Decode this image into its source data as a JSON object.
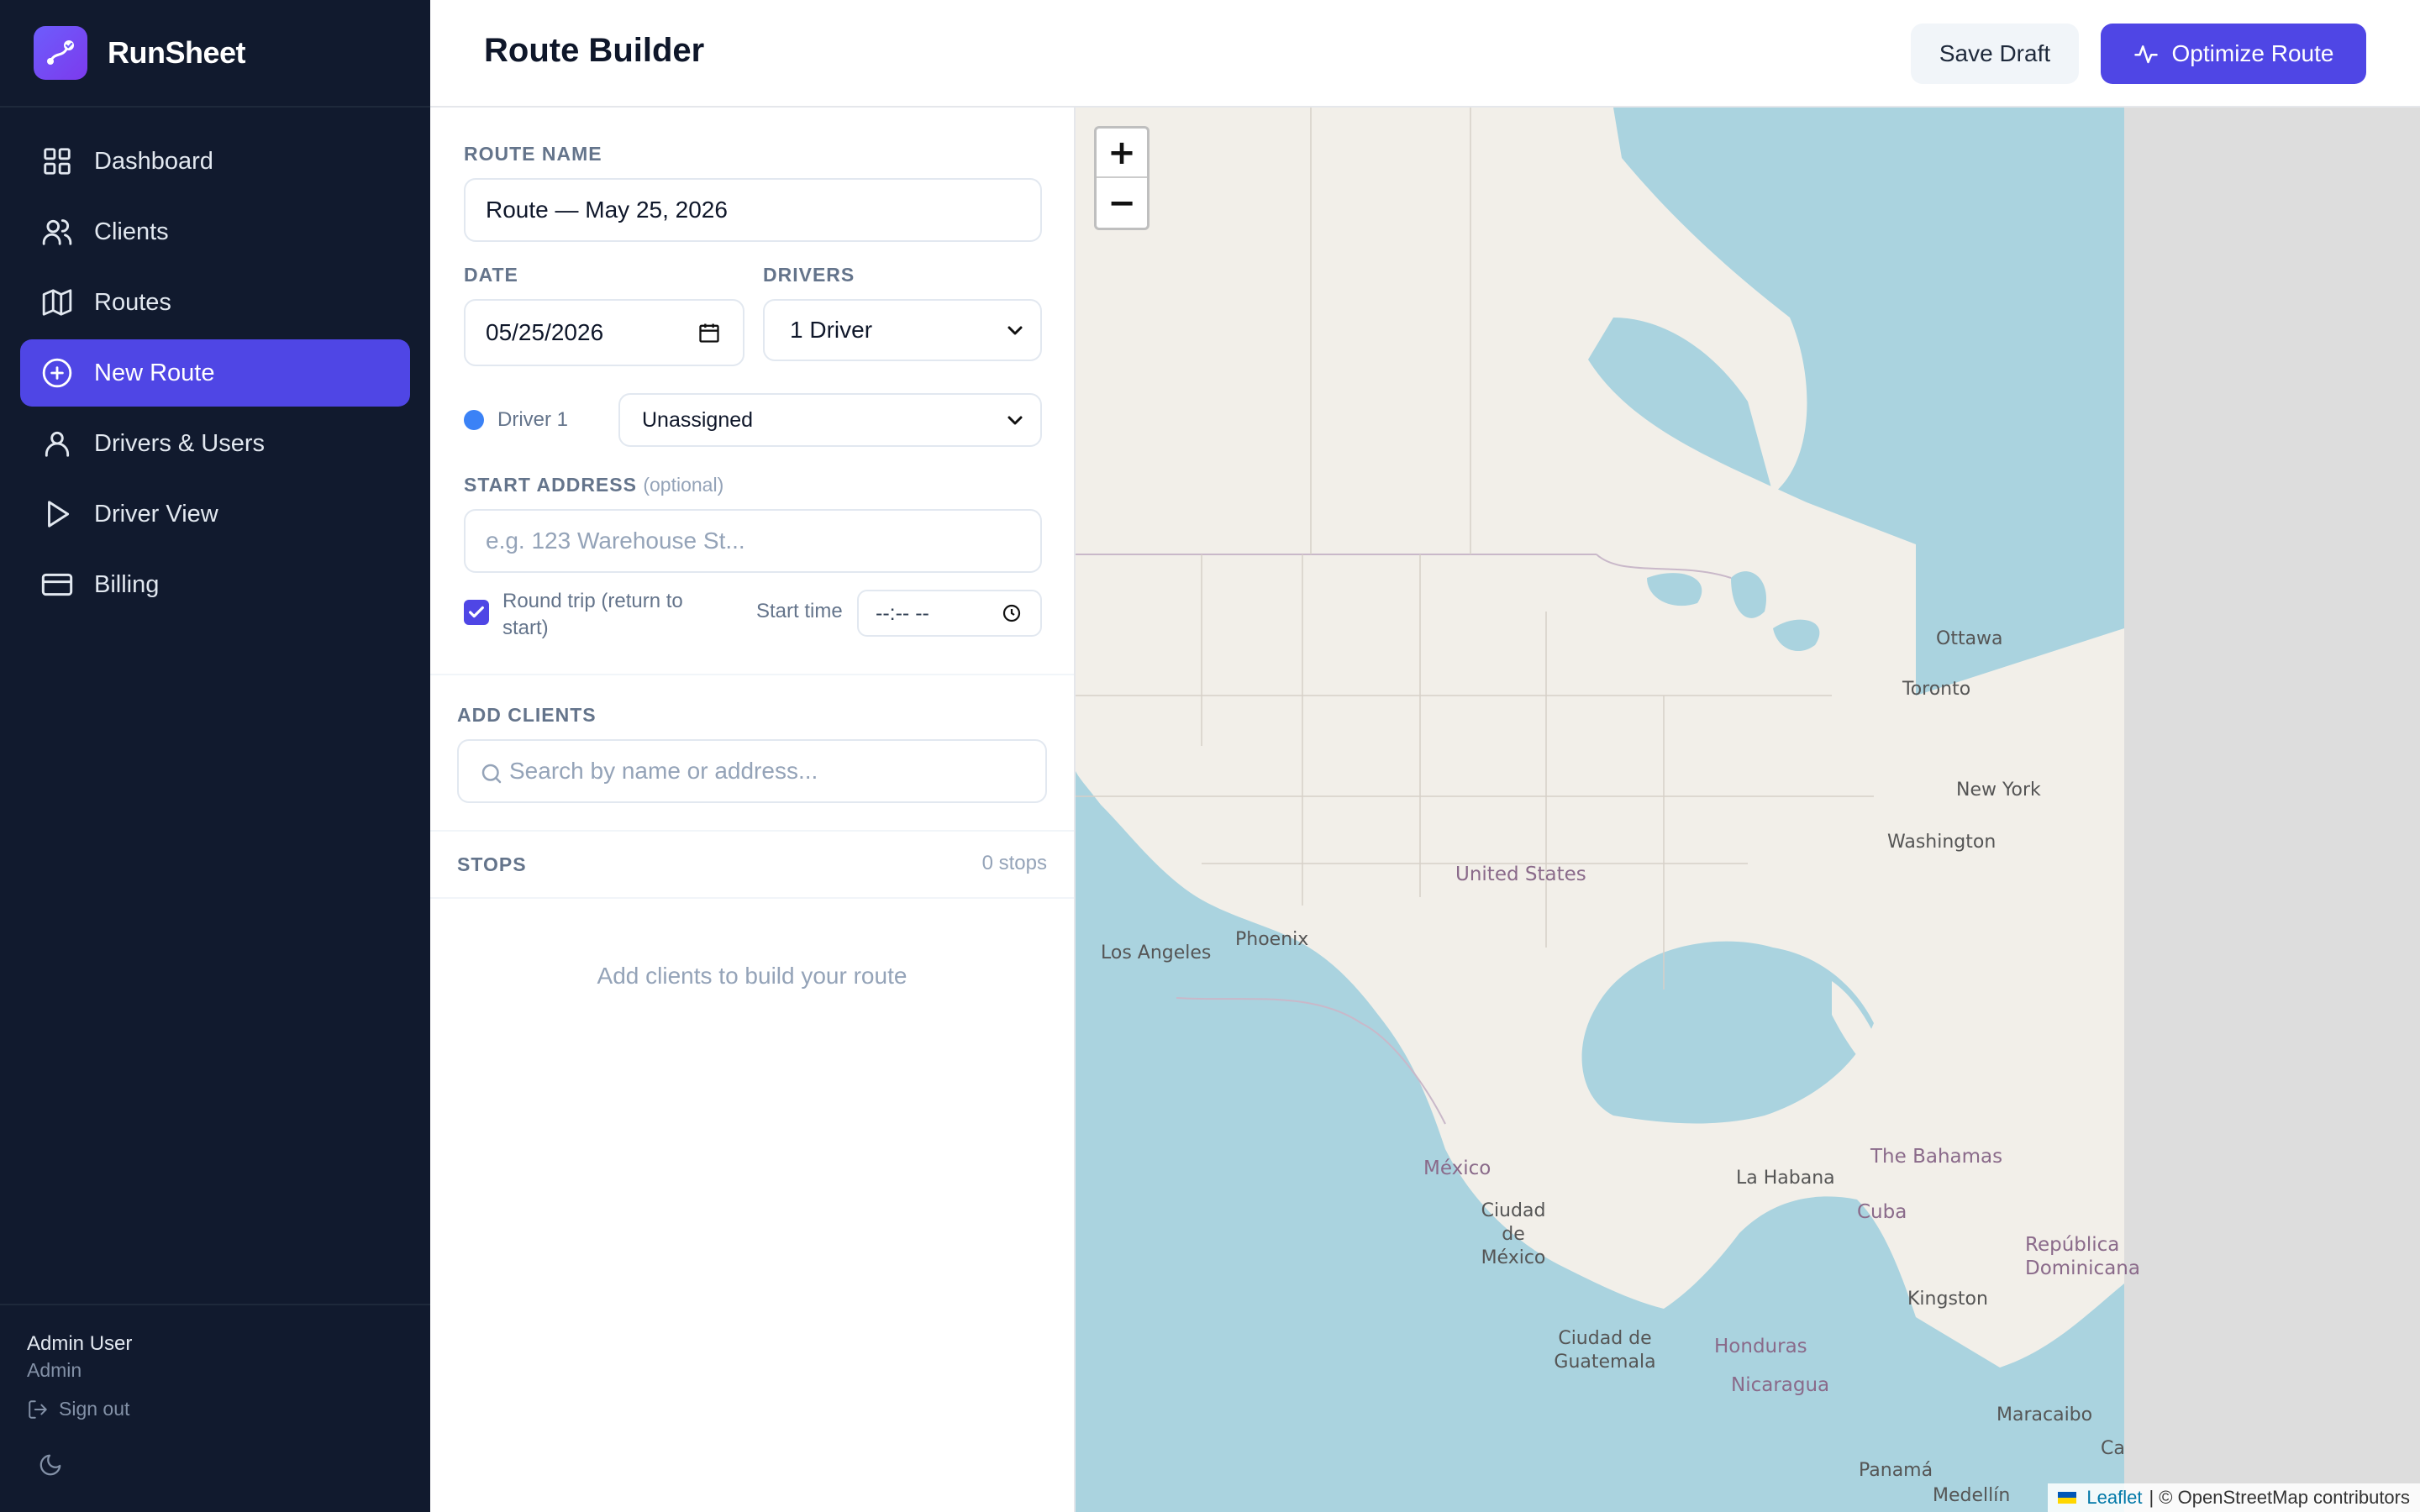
{
  "app": {
    "name": "RunSheet",
    "logo_icon": "route-logo-icon"
  },
  "sidebar": {
    "items": [
      {
        "label": "Dashboard",
        "icon": "grid-icon",
        "active": false
      },
      {
        "label": "Clients",
        "icon": "users-icon",
        "active": false
      },
      {
        "label": "Routes",
        "icon": "map-icon",
        "active": false
      },
      {
        "label": "New Route",
        "icon": "plus-circle-icon",
        "active": true
      },
      {
        "label": "Drivers & Users",
        "icon": "user-icon",
        "active": false
      },
      {
        "label": "Driver View",
        "icon": "play-icon",
        "active": false
      },
      {
        "label": "Billing",
        "icon": "credit-card-icon",
        "active": false
      }
    ],
    "user": {
      "name": "Admin User",
      "role": "Admin",
      "signout_label": "Sign out"
    }
  },
  "header": {
    "title": "Route Builder",
    "save_draft_label": "Save Draft",
    "optimize_label": "Optimize Route"
  },
  "form": {
    "route_name_label": "ROUTE NAME",
    "route_name_value": "Route — May 25, 2026",
    "date_label": "DATE",
    "date_value": "05/25/2026",
    "drivers_label": "DRIVERS",
    "drivers_value": "1 Driver",
    "driver_1_label": "Driver 1",
    "driver_1_value": "Unassigned",
    "start_address_label": "START ADDRESS",
    "start_address_optional": "(optional)",
    "start_address_placeholder": "e.g. 123 Warehouse St...",
    "round_trip_label": "Round trip (return to start)",
    "round_trip_checked": true,
    "start_time_label": "Start time",
    "start_time_value": "--:-- --"
  },
  "clients": {
    "label": "ADD CLIENTS",
    "search_placeholder": "Search by name or address..."
  },
  "stops": {
    "label": "STOPS",
    "count": "0 stops",
    "empty_text": "Add clients to build your route"
  },
  "map": {
    "zoom_in": "+",
    "zoom_out": "−",
    "attribution_leaflet": "Leaflet",
    "attribution_rest": "| © OpenStreetMap contributors",
    "labels": {
      "ottawa": "Ottawa",
      "toronto": "Toronto",
      "new_york": "New York",
      "washington": "Washington",
      "united_states": "United States",
      "los_angeles": "Los Angeles",
      "phoenix": "Phoenix",
      "mexico": "México",
      "mexico_city": "Ciudad de México",
      "la_habana": "La Habana",
      "cuba": "Cuba",
      "bahamas": "The Bahamas",
      "republica_dominicana": "República Dominicana",
      "kingston": "Kingston",
      "guatemala": "Ciudad de Guatemala",
      "honduras": "Honduras",
      "nicaragua": "Nicaragua",
      "panama": "Panamá",
      "maracaibo": "Maracaibo",
      "medellin": "Medellín",
      "ca": "Ca"
    },
    "colors": {
      "water": "#aad3df",
      "land": "#f2efe9",
      "border": "#c9b8c9",
      "unloaded": "#dddddd"
    }
  },
  "colors": {
    "accent": "#4f46e5",
    "sidebar_bg": "#111a2e",
    "driver_1": "#3b82f6"
  }
}
